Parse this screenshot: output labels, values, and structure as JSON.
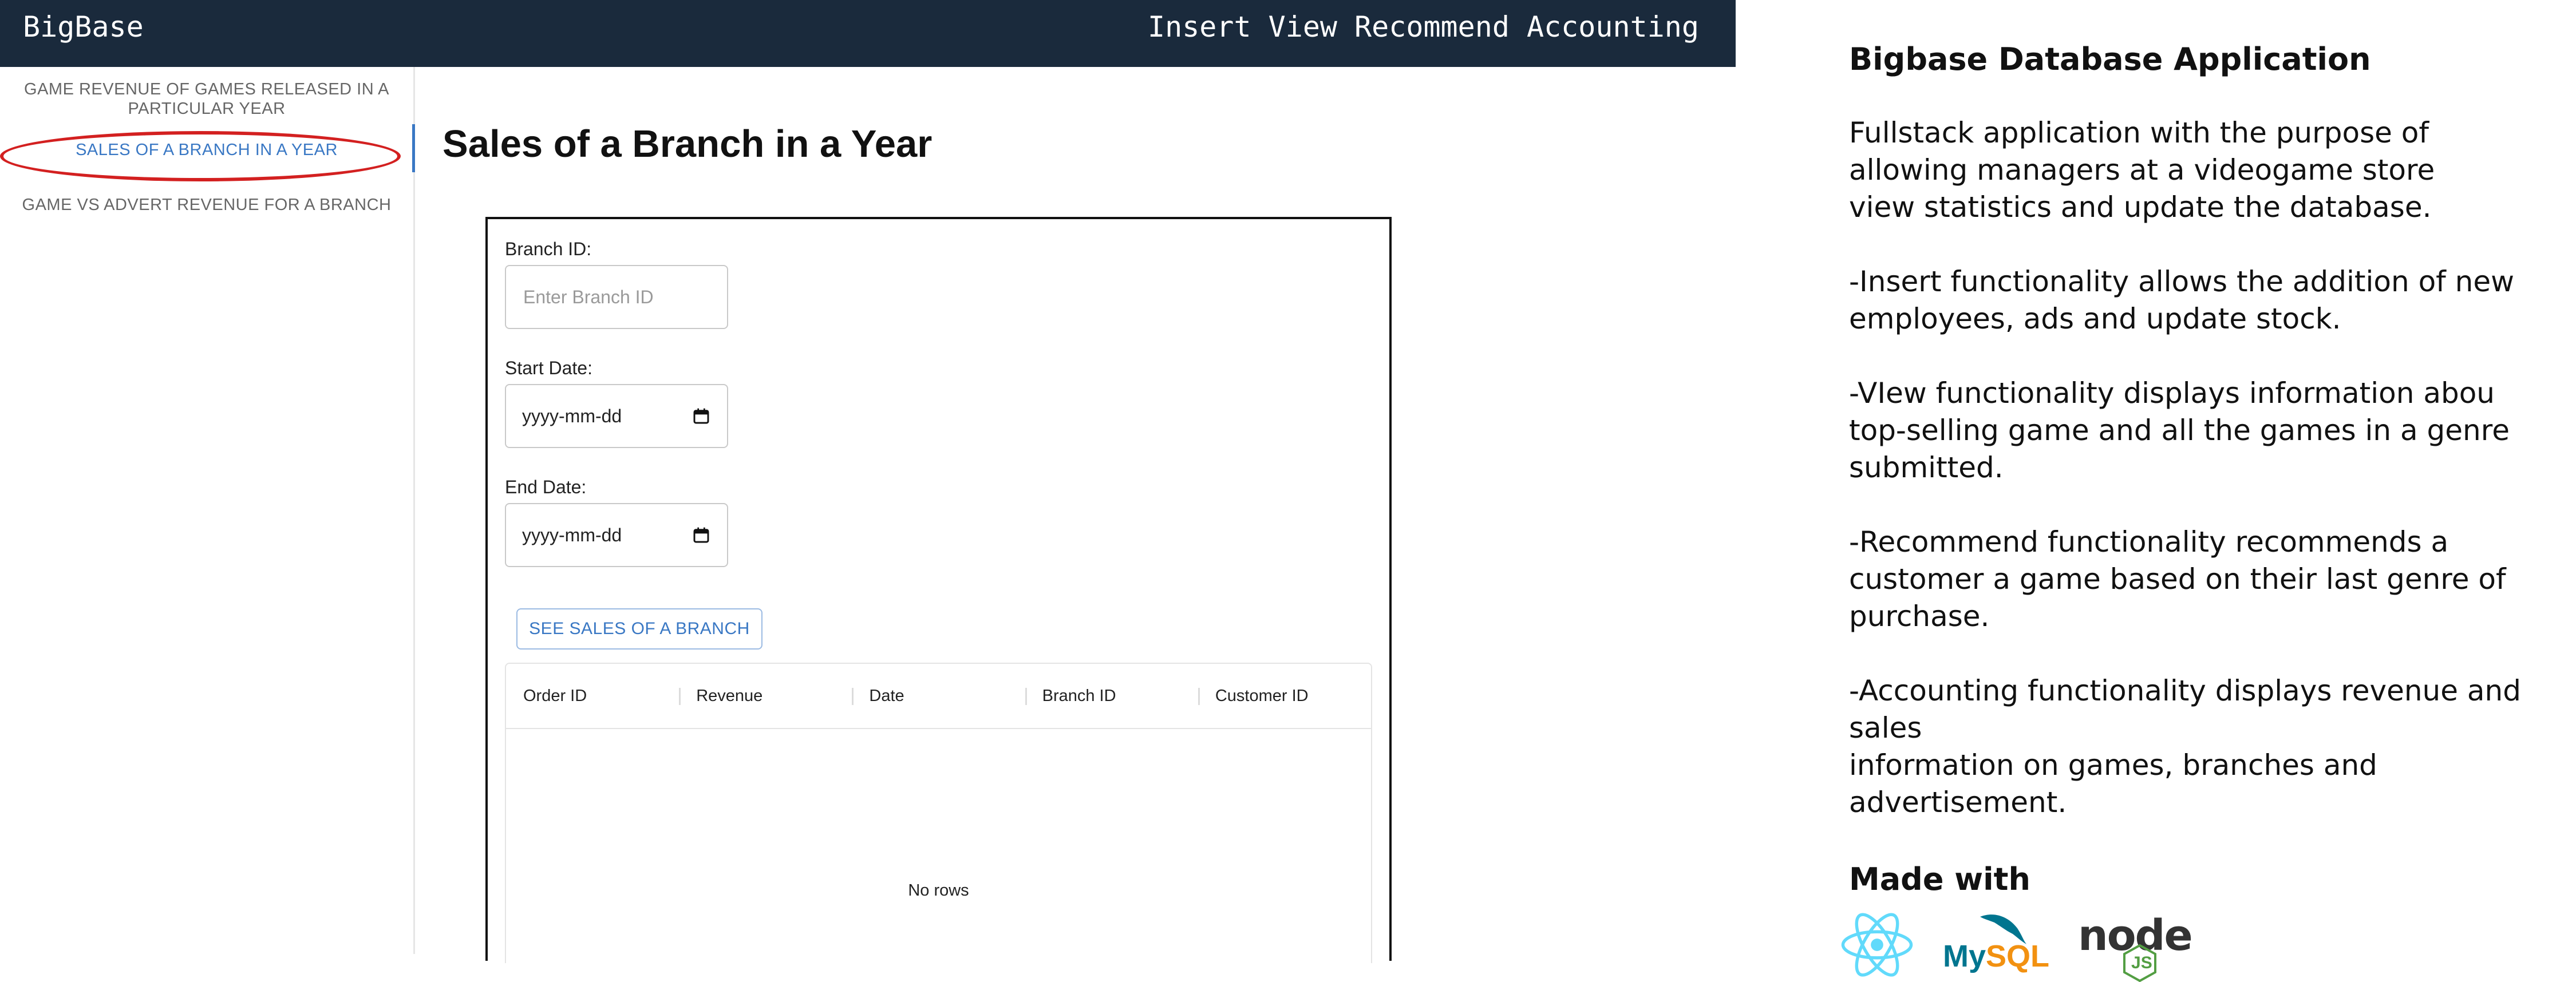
{
  "appbar": {
    "brand": "BigBase",
    "nav": [
      "Insert",
      "View",
      "Recommend",
      "Accounting"
    ]
  },
  "sidebar": {
    "items": [
      {
        "label": "GAME REVENUE OF GAMES RELEASED IN A PARTICULAR YEAR",
        "active": false
      },
      {
        "label": "SALES OF A BRANCH IN A YEAR",
        "active": true
      },
      {
        "label": "GAME VS ADVERT REVENUE FOR A BRANCH",
        "active": false
      }
    ]
  },
  "main": {
    "title": "Sales of a Branch in a Year",
    "form": {
      "branch_label": "Branch ID:",
      "branch_placeholder": "Enter Branch ID",
      "start_label": "Start Date:",
      "start_value": "yyyy-mm-dd",
      "end_label": "End Date:",
      "end_value": "yyyy-mm-dd",
      "submit_label": "SEE SALES OF A BRANCH"
    },
    "grid": {
      "columns": [
        "Order ID",
        "Revenue",
        "Date",
        "Branch ID",
        "Customer ID"
      ],
      "empty_text": "No rows"
    }
  },
  "panel": {
    "title": "Bigbase Database Application",
    "paragraphs": [
      "Fullstack application with the purpose of\nallowing managers at a videogame store\nview statistics and update the database.",
      "-Insert functionality allows the addition of new\nemployees, ads and update stock.",
      "-VIew functionality displays information abou\ntop-selling game and all the games in a genre\nsubmitted.",
      "-Recommend functionality recommends a\ncustomer a game based on their last genre of\npurchase.",
      "-Accounting functionality displays revenue and sales\ninformation on games, branches and advertisement."
    ],
    "made_with": "Made with",
    "logos": [
      "react-logo",
      "mysql-logo",
      "nodejs-logo"
    ],
    "mysql_text_my": "My",
    "mysql_text_sql": "SQL",
    "node_text": "node",
    "node_js_text": "JS"
  },
  "colors": {
    "appbar_bg": "#1a2a3c",
    "accent": "#3a78c4",
    "highlight": "#d32020"
  }
}
